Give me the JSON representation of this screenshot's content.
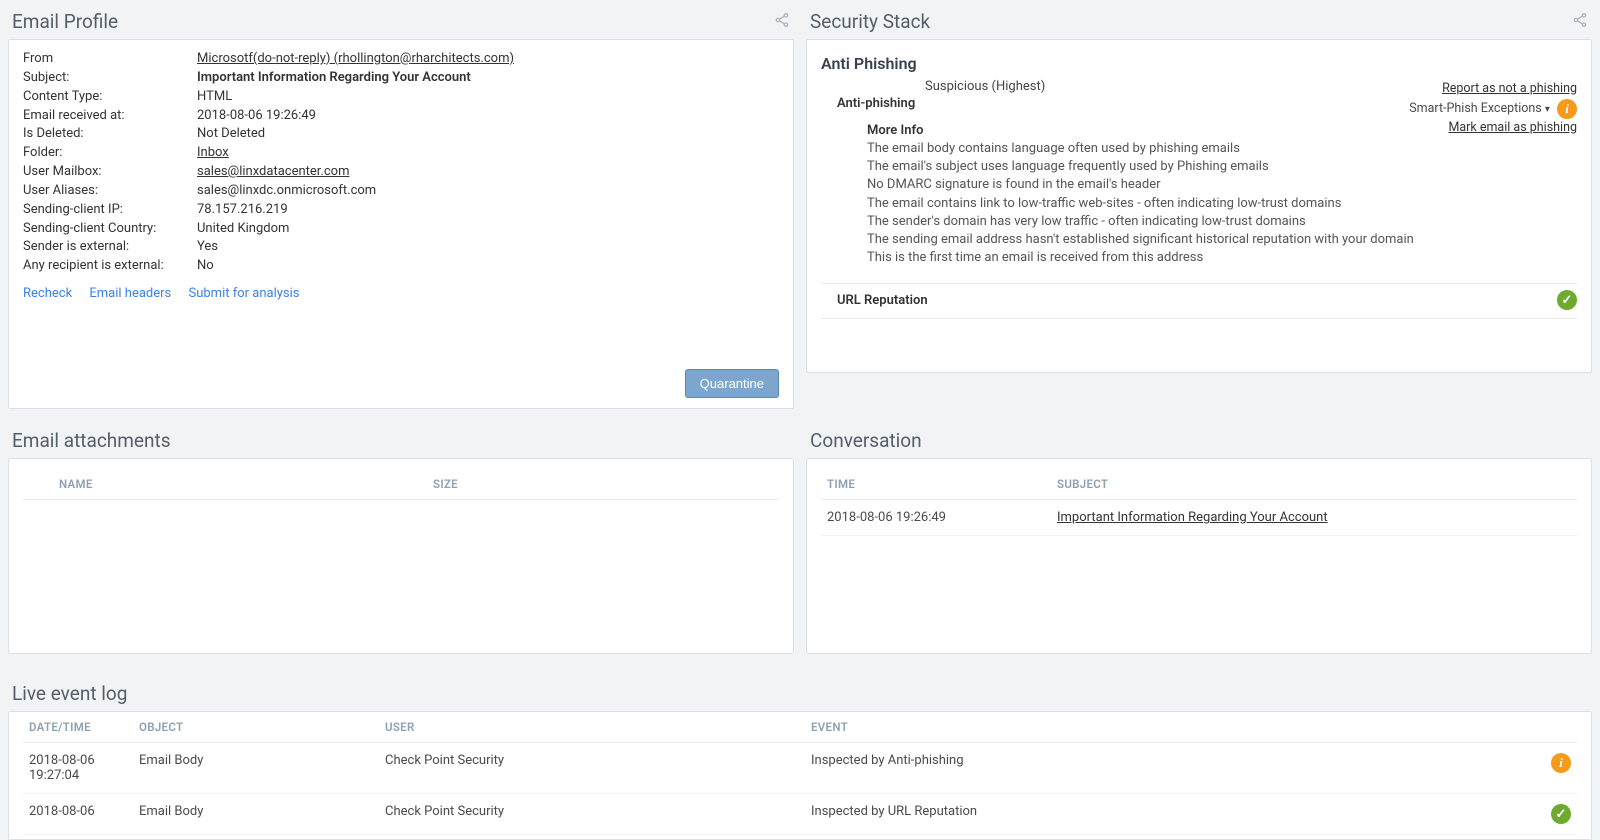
{
  "email_profile": {
    "title": "Email Profile",
    "fields": {
      "from_label": "From",
      "from_value": "Microsotf(do-not-reply) (rhollington@rharchitects.com)",
      "subject_label": "Subject:",
      "subject_value": "Important Information Regarding Your Account",
      "content_type_label": "Content Type:",
      "content_type_value": "HTML",
      "received_at_label": "Email received at:",
      "received_at_value": "2018-08-06 19:26:49",
      "is_deleted_label": "Is Deleted:",
      "is_deleted_value": "Not Deleted",
      "folder_label": "Folder:",
      "folder_value": "Inbox",
      "user_mailbox_label": "User Mailbox:",
      "user_mailbox_value": "sales@linxdatacenter.com",
      "user_aliases_label": "User Aliases:",
      "user_aliases_value": "sales@linxdc.onmicrosoft.com",
      "sending_ip_label": "Sending-client IP:",
      "sending_ip_value": "78.157.216.219",
      "sending_country_label": "Sending-client Country:",
      "sending_country_value": "United Kingdom",
      "sender_external_label": "Sender is external:",
      "sender_external_value": "Yes",
      "recipient_external_label": "Any recipient is external:",
      "recipient_external_value": "No"
    },
    "actions": {
      "recheck": "Recheck",
      "headers": "Email headers",
      "submit": "Submit for analysis",
      "quarantine": "Quarantine"
    }
  },
  "security_stack": {
    "title": "Security Stack",
    "anti_phishing_header": "Anti Phishing",
    "anti_phishing_sub": "Anti-phishing",
    "status_text": "Suspicious   (Highest)",
    "actions": {
      "report_not": "Report as not a phishing",
      "smart_phish": "Smart-Phish Exceptions",
      "mark_phishing": "Mark email as phishing"
    },
    "more_info_title": "More Info",
    "more_info_lines": [
      "The email body contains language often used by phishing emails",
      "The email's subject uses language frequently used by Phishing emails",
      "No DMARC signature is found in the email's header",
      "The email contains link to low-traffic web-sites - often indicating low-trust domains",
      "The sender's domain has very low traffic - often indicating low-trust domains",
      "The sending email address hasn't established significant historical reputation with your domain",
      "This is the first time an email is received from this address"
    ],
    "url_reputation_label": "URL Reputation"
  },
  "attachments": {
    "title": "Email attachments",
    "columns": {
      "name": "NAME",
      "size": "SIZE"
    }
  },
  "conversation": {
    "title": "Conversation",
    "columns": {
      "time": "TIME",
      "subject": "SUBJECT"
    },
    "rows": [
      {
        "time": "2018-08-06 19:26:49",
        "subject": "Important Information Regarding Your Account"
      }
    ]
  },
  "event_log": {
    "title": "Live event log",
    "columns": {
      "datetime": "DATE/TIME",
      "object": "OBJECT",
      "user": "USER",
      "event": "EVENT"
    },
    "rows": [
      {
        "datetime": "2018-08-06 19:27:04",
        "object": "Email Body",
        "user": "Check Point Security",
        "event": "Inspected by Anti-phishing",
        "status": "warn"
      },
      {
        "datetime": "2018-08-06",
        "object": "Email Body",
        "user": "Check Point Security",
        "event": "Inspected by URL Reputation",
        "status": "ok"
      }
    ]
  }
}
